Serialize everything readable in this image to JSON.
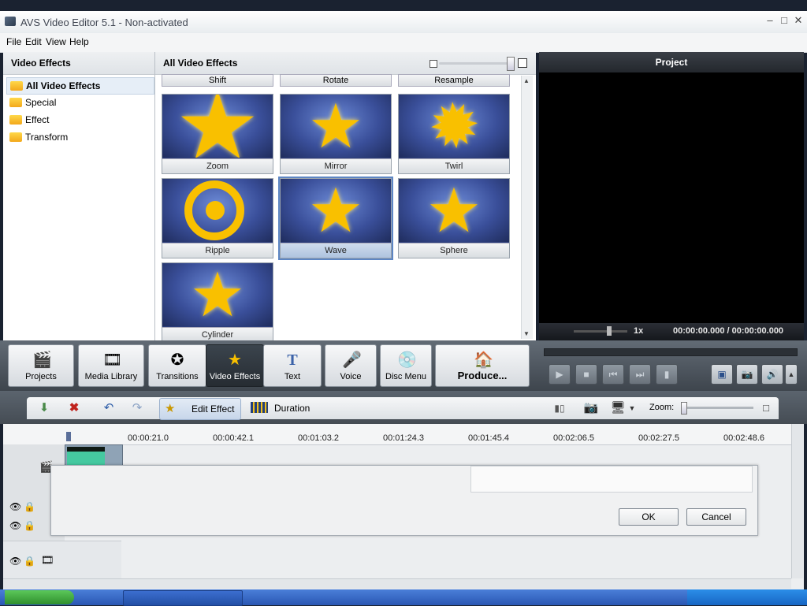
{
  "window": {
    "title": "AVS Video Editor 5.1 - Non-activated"
  },
  "menu": [
    "File",
    "Edit",
    "View",
    "Help"
  ],
  "left_panel": {
    "header": "Video Effects",
    "items": [
      {
        "label": "All Video Effects"
      },
      {
        "label": "Special"
      },
      {
        "label": "Effect"
      },
      {
        "label": "Transform"
      }
    ]
  },
  "center_panel": {
    "header": "All Video Effects",
    "top_row": [
      "Shift",
      "Rotate",
      "Resample"
    ],
    "tiles": [
      {
        "label": "Zoom"
      },
      {
        "label": "Mirror"
      },
      {
        "label": "Twirl"
      },
      {
        "label": "Ripple"
      },
      {
        "label": "Wave"
      },
      {
        "label": "Sphere"
      },
      {
        "label": "Cylinder"
      }
    ]
  },
  "preview": {
    "header": "Project",
    "speed": "1x",
    "time": "00:00:00.000 / 00:00:00.000"
  },
  "big_toolbar": [
    {
      "label": "Projects",
      "icon": "clapper-icon"
    },
    {
      "label": "Media Library",
      "icon": "film-icon"
    },
    {
      "label": "Transitions",
      "icon": "transition-icon"
    },
    {
      "label": "Video Effects",
      "icon": "effects-icon"
    },
    {
      "label": "Text",
      "icon": "text-icon"
    },
    {
      "label": "Voice",
      "icon": "microphone-icon"
    },
    {
      "label": "Disc Menu",
      "icon": "disc-icon"
    },
    {
      "label": "Produce...",
      "icon": "produce-icon"
    }
  ],
  "edit_toolbar": {
    "edit_effect": "Edit Effect",
    "duration": "Duration",
    "zoom_label": "Zoom:"
  },
  "timeline": {
    "ticks": [
      "00:00:21.0",
      "00:00:42.1",
      "00:01:03.2",
      "00:01:24.3",
      "00:01:45.4",
      "00:02:06.5",
      "00:02:27.5",
      "00:02:48.6"
    ]
  },
  "dialog": {
    "ok": "OK",
    "cancel": "Cancel"
  },
  "colors": {
    "accent": "#f9c000",
    "dark_panel": "#3e454d",
    "selection": "#5d86c4"
  }
}
